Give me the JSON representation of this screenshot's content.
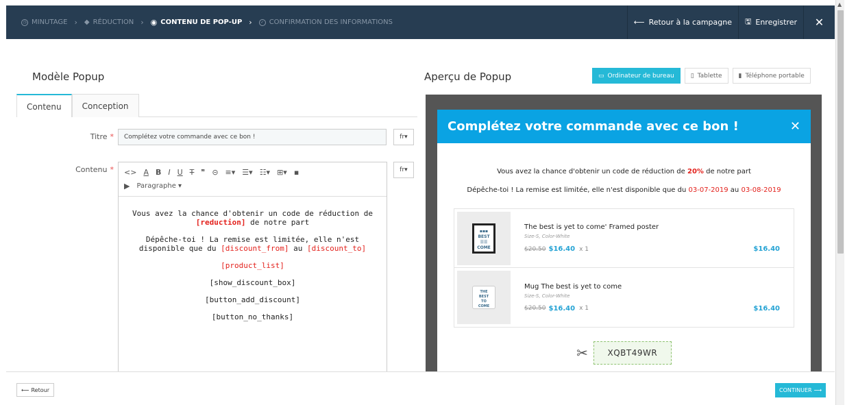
{
  "topbar": {
    "steps": [
      {
        "label": "Minutage",
        "icon": "clock-icon"
      },
      {
        "label": "Réduction",
        "icon": "tag-icon"
      },
      {
        "label": "Contenu de pop-up",
        "icon": "eye-icon"
      },
      {
        "label": "Confirmation des informations",
        "icon": "check-circle-icon"
      }
    ],
    "back_campaign": "Retour à la campagne",
    "save": "Enregistrer",
    "close": "✕"
  },
  "left": {
    "heading": "Modèle Popup",
    "tabs": [
      "Contenu",
      "Conception"
    ],
    "title_label": "Titre",
    "title_value": "Complétez votre commande avec ce bon !",
    "content_label": "Contenu",
    "lang": "fr",
    "paragraph": "Paragraphe",
    "editor": {
      "line1_a": "Vous avez la chance d'obtenir un code de réduction de ",
      "line1_tag": "[reduction]",
      "line1_b": " de notre part",
      "line2_a": "Dépêche-toi ! La remise est limitée, elle n'est disponible que du ",
      "line2_tag1": "[discount_from]",
      "line2_mid": " au ",
      "line2_tag2": "[discount_to]",
      "product_list": "[product_list]",
      "show_discount_box": "[show_discount_box]",
      "button_add_discount": "[button_add_discount]",
      "button_no_thanks": "[button_no_thanks]"
    }
  },
  "right": {
    "heading": "Aperçu de Popup",
    "views": [
      "Ordinateur de bureau",
      "Tablette",
      "Téléphone portable"
    ],
    "popup": {
      "title": "Complétez votre commande avec ce bon !",
      "line1_a": "Vous avez la chance d'obtenir un code de réduction de ",
      "line1_val": "20%",
      "line1_b": " de notre part",
      "line2_a": "Dépêche-toi ! La remise est limitée, elle n'est disponible que du ",
      "date_from": "03-07-2019",
      "line2_mid": " au ",
      "date_to": "03-08-2019",
      "products": [
        {
          "name": "The best is yet to come' Framed poster",
          "attr": "Size-S, Color-White",
          "old": "$20.50",
          "new": "$16.40",
          "qty": "x 1",
          "total": "$16.40"
        },
        {
          "name": "Mug The best is yet to come",
          "attr": "Size-S, Color-White",
          "old": "$20.50",
          "new": "$16.40",
          "qty": "x 1",
          "total": "$16.40"
        }
      ],
      "coupon_code": "XQBT49WR"
    }
  },
  "footer": {
    "back": "Retour",
    "continue": "Continuer"
  }
}
